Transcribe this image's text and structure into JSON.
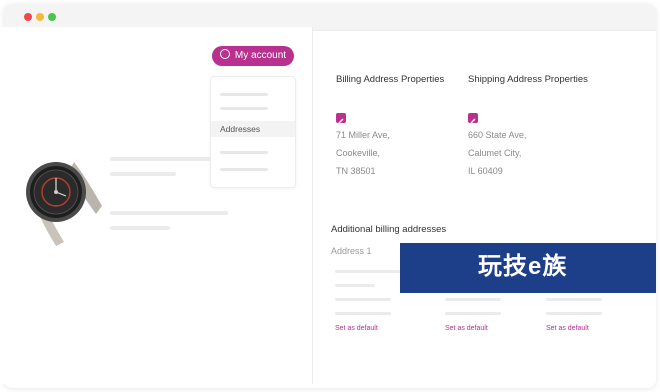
{
  "window": {
    "traffic_lights": [
      "#f0474c",
      "#f6b93b",
      "#49c549"
    ]
  },
  "account": {
    "label": "My account",
    "icon": "user-icon",
    "accent": "#b8318f"
  },
  "menu": {
    "active_item": "Addresses"
  },
  "billing": {
    "heading": "Billing Address Properties",
    "edit_icon": "pencil-icon",
    "lines": [
      "71 Miller Ave,",
      "Cookeville,",
      "TN 38501"
    ]
  },
  "shipping": {
    "heading": "Shipping Address Properties",
    "edit_icon": "pencil-icon",
    "lines": [
      "660 State Ave,",
      "Calumet City,",
      "IL 60409"
    ]
  },
  "additional": {
    "title": "Additional billing addresses",
    "first_label": "Address 1",
    "set_default": [
      "Set as default",
      "Set as default",
      "Set as default"
    ]
  },
  "banner": {
    "text": "玩技e族",
    "color": "#1d3f8a"
  }
}
